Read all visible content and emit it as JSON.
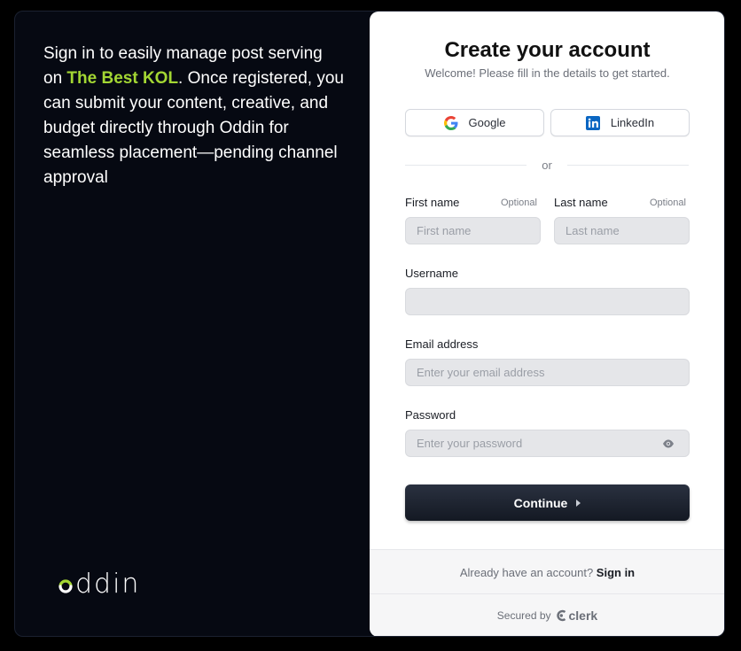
{
  "promo": {
    "text_before": "Sign in to easily manage post serving on ",
    "highlight": "The Best KOL",
    "text_after": ". Once registered, you can submit your content, creative, and budget directly through Oddin for seamless placement—pending channel approval"
  },
  "brand": {
    "logo_text": "ddin",
    "accent_color": "#a3d633"
  },
  "card": {
    "title": "Create your account",
    "subtitle": "Welcome! Please fill in the details to get started.",
    "social": {
      "google_label": "Google",
      "linkedin_label": "LinkedIn"
    },
    "divider_text": "or",
    "fields": {
      "first_name": {
        "label": "First name",
        "optional": "Optional",
        "placeholder": "First name"
      },
      "last_name": {
        "label": "Last name",
        "optional": "Optional",
        "placeholder": "Last name"
      },
      "username": {
        "label": "Username",
        "placeholder": ""
      },
      "email": {
        "label": "Email address",
        "placeholder": "Enter your email address"
      },
      "password": {
        "label": "Password",
        "placeholder": "Enter your password"
      }
    },
    "continue_label": "Continue"
  },
  "footer": {
    "have_account": "Already have an account?",
    "sign_in_link": "Sign in",
    "secured_by": "Secured by",
    "clerk_label": "clerk"
  }
}
